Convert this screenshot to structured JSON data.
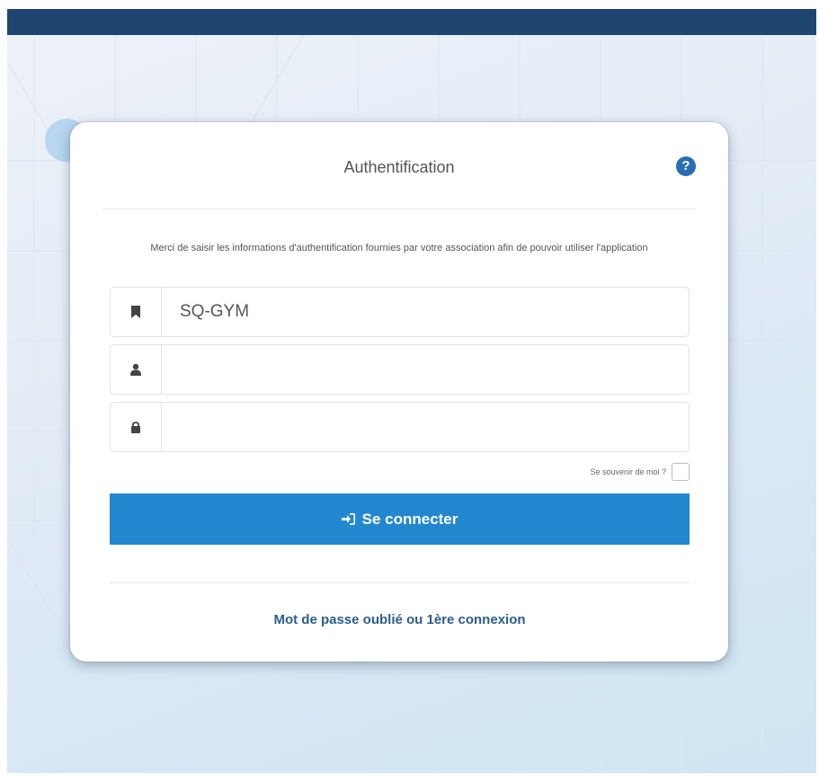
{
  "colors": {
    "topbar": "#1f4670",
    "accent": "#2387d0",
    "link": "#2a5d8f",
    "help": "#2a6db3"
  },
  "card": {
    "title": "Authentification",
    "help_icon": "question-circle-icon",
    "help_glyph": "?",
    "intro": "Merci de saisir les informations d'authentification fournies par votre association afin de pouvoir utiliser l'application"
  },
  "form": {
    "association": {
      "icon": "bookmark-icon",
      "value": "SQ-GYM"
    },
    "username": {
      "icon": "user-icon",
      "value": ""
    },
    "password": {
      "icon": "lock-icon",
      "value": ""
    },
    "remember_label": "Se souvenir de moi ?",
    "submit_icon": "sign-in-icon",
    "submit_label": "Se connecter"
  },
  "links": {
    "forgot": "Mot de passe oublié ou 1ère connexion"
  }
}
